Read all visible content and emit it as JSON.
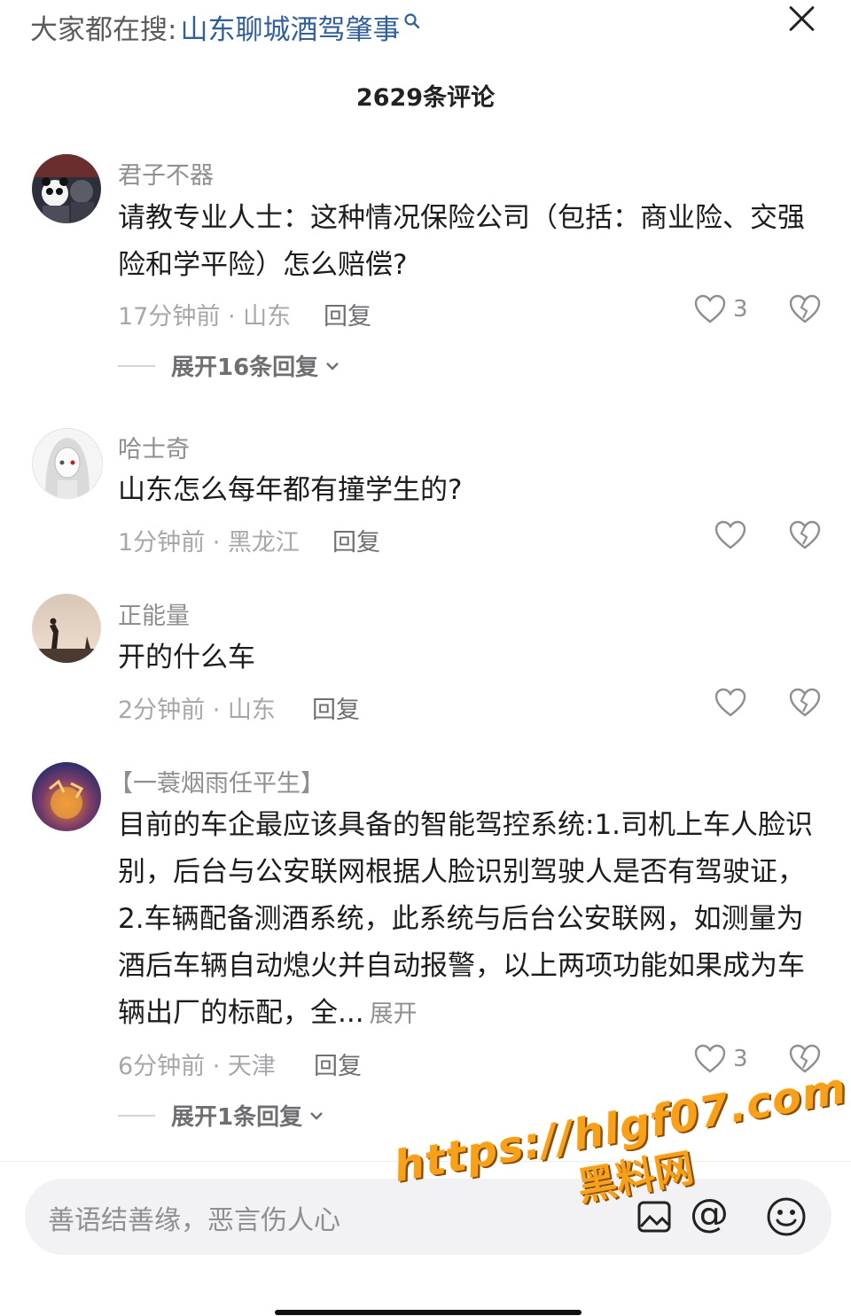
{
  "search": {
    "prefix": "大家都在搜:",
    "query": "山东聊城酒驾肇事"
  },
  "comment_count": "2629条评论",
  "comments": [
    {
      "username": "君子不器",
      "text": "请教专业人士：这种情况保险公司（包括：商业险、交强险和学平险）怎么赔偿?",
      "meta": "17分钟前 · 山东",
      "reply": "回复",
      "likes": "3",
      "expand": "展开16条回复"
    },
    {
      "username": "哈士奇",
      "text": "山东怎么每年都有撞学生的?",
      "meta": "1分钟前 · 黑龙江",
      "reply": "回复",
      "likes": ""
    },
    {
      "username": "正能量",
      "text": "开的什么车",
      "meta": "2分钟前 · 山东",
      "reply": "回复",
      "likes": ""
    },
    {
      "username": "【一蓑烟雨任平生】",
      "text": "目前的车企最应该具备的智能驾控系统:1.司机上车人脸识别，后台与公安联网根据人脸识别驾驶人是否有驾驶证，2.车辆配备测酒系统，此系统与后台公安联网，如测量为酒后车辆自动熄火并自动报警，以上两项功能如果成为车辆出厂的标配，全...",
      "more": "展开",
      "meta": "6分钟前 · 天津",
      "reply": "回复",
      "likes": "3",
      "expand": "展开1条回复"
    }
  ],
  "input": {
    "placeholder": "善语结善缘，恶言伤人心",
    "at": "@"
  },
  "watermark": {
    "line1": "https://hlgf07.com",
    "line2": "黑料网"
  },
  "colors": {
    "link": "#315f99",
    "muted": "#8e8e93",
    "watermark": "#f7a11a"
  }
}
